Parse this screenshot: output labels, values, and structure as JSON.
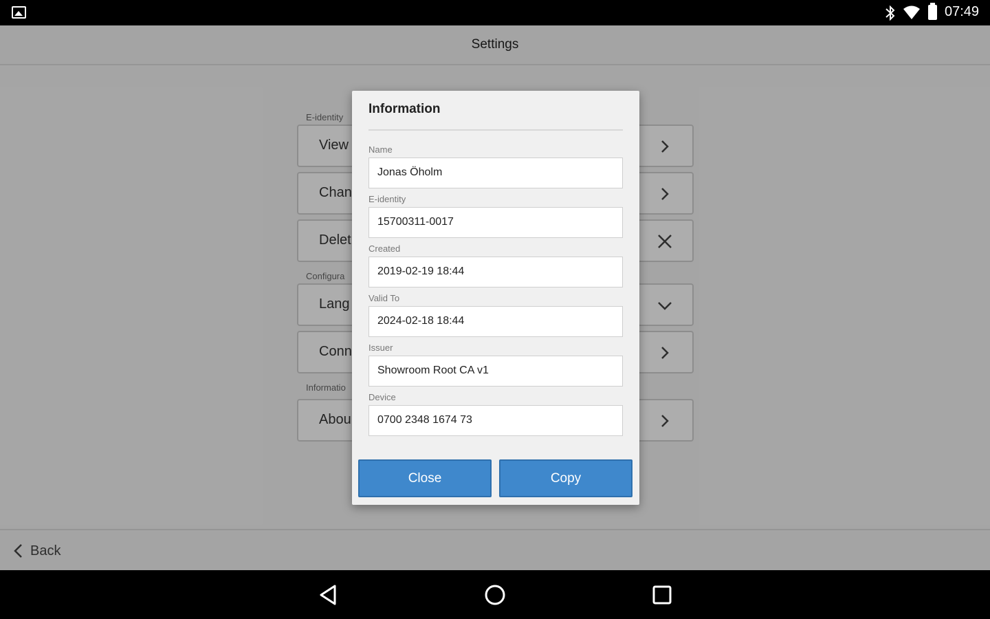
{
  "status_bar": {
    "time": "07:49",
    "icons": [
      "gallery-icon",
      "bluetooth-icon",
      "wifi-icon",
      "battery-icon"
    ]
  },
  "header": {
    "title": "Settings"
  },
  "sections": [
    {
      "label": "E-identity",
      "items": [
        {
          "label": "View",
          "icon": "chevron-right-icon"
        },
        {
          "label": "Chan",
          "icon": "chevron-right-icon"
        },
        {
          "label": "Delet",
          "icon": "close-icon"
        }
      ]
    },
    {
      "label": "Configura",
      "items": [
        {
          "label": "Lang",
          "icon": "chevron-down-icon"
        },
        {
          "label": "Conn",
          "icon": "chevron-right-icon"
        }
      ]
    },
    {
      "label": "Informatio",
      "items": [
        {
          "label": "Abou",
          "icon": "chevron-right-icon"
        }
      ]
    }
  ],
  "footer": {
    "back_label": "Back"
  },
  "dialog": {
    "title": "Information",
    "fields": [
      {
        "label": "Name",
        "value": "Jonas Öholm"
      },
      {
        "label": "E-identity",
        "value": "15700311-0017"
      },
      {
        "label": "Created",
        "value": "2019-02-19 18:44"
      },
      {
        "label": "Valid To",
        "value": "2024-02-18 18:44"
      },
      {
        "label": "Issuer",
        "value": "Showroom Root CA v1"
      },
      {
        "label": "Device",
        "value": "0700 2348 1674 73"
      }
    ],
    "close_label": "Close",
    "copy_label": "Copy"
  },
  "colors": {
    "primary_button": "#3f88cc",
    "overlay": "rgba(0,0,0,0.32)"
  }
}
